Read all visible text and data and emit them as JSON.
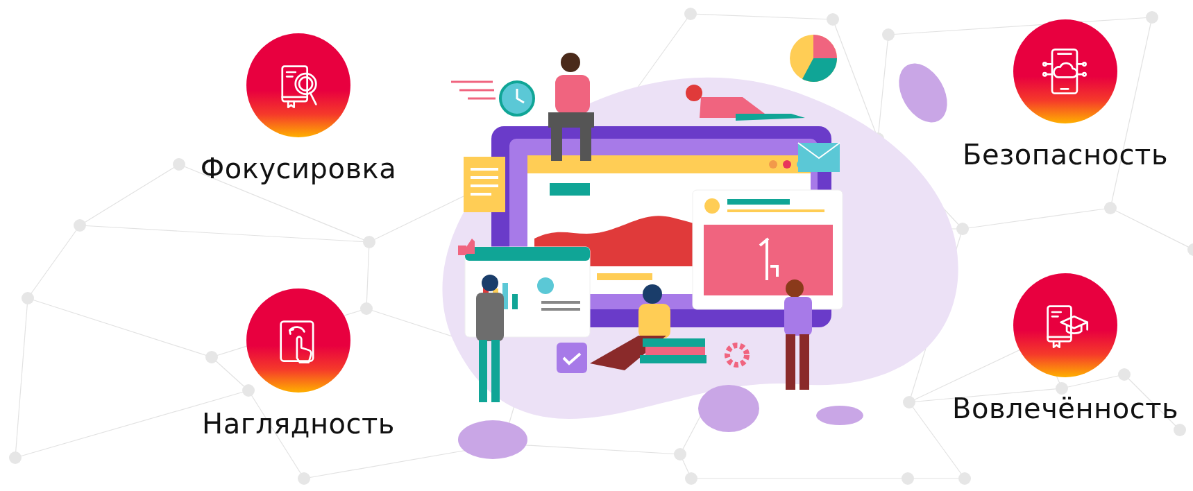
{
  "left_features": [
    {
      "label": "Фокусировка",
      "kind": "book-magnifier"
    },
    {
      "label": "Наглядность",
      "kind": "tablet-touch"
    }
  ],
  "right_features": [
    {
      "label": "Безопасность",
      "kind": "phone-cloud"
    },
    {
      "label": "Вовлечённость",
      "kind": "book-graduation"
    }
  ]
}
